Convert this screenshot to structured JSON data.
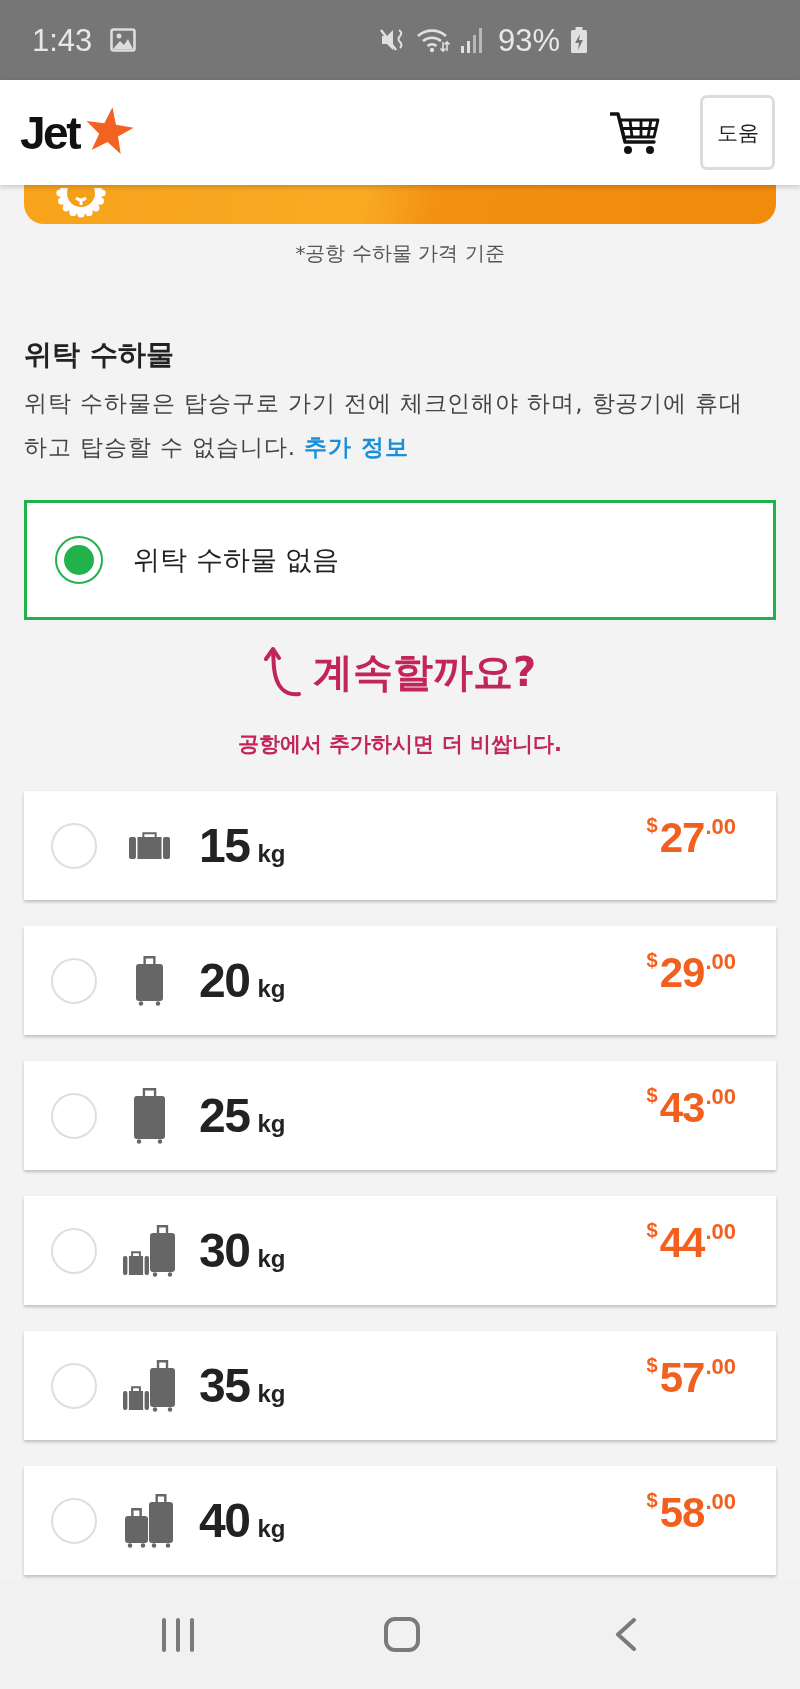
{
  "status_bar": {
    "time": "1:43",
    "battery": "93%"
  },
  "header": {
    "logo": "Jet",
    "help_button": "도움"
  },
  "price_note": "*공항 수하물 가격 기준",
  "section": {
    "title": "위탁 수하물",
    "description": "위탁 수하물은 탑승구로 가기 전에 체크인해야 하며, 항공기에 휴대하고 탑승할 수 없습니다.",
    "link": "추가 정보"
  },
  "no_bag_option": {
    "label": "위탁 수하물 없음",
    "selected": true
  },
  "prompt": {
    "question": "계속할까요?",
    "note": "공항에서 추가하시면 더 비쌉니다."
  },
  "bag_options": [
    {
      "kind": "briefcase",
      "weight": "15",
      "unit": "kg",
      "currency": "$",
      "amount": "27",
      "cents": ".00",
      "selected": false
    },
    {
      "kind": "suitcase",
      "weight": "20",
      "unit": "kg",
      "currency": "$",
      "amount": "29",
      "cents": ".00",
      "selected": false
    },
    {
      "kind": "suitcase-large",
      "weight": "25",
      "unit": "kg",
      "currency": "$",
      "amount": "43",
      "cents": ".00",
      "selected": false
    },
    {
      "kind": "suitcase-briefcase",
      "weight": "30",
      "unit": "kg",
      "currency": "$",
      "amount": "44",
      "cents": ".00",
      "selected": false
    },
    {
      "kind": "suitcase-briefcase",
      "weight": "35",
      "unit": "kg",
      "currency": "$",
      "amount": "57",
      "cents": ".00",
      "selected": false
    },
    {
      "kind": "two-suitcases",
      "weight": "40",
      "unit": "kg",
      "currency": "$",
      "amount": "58",
      "cents": ".00",
      "selected": false
    }
  ]
}
